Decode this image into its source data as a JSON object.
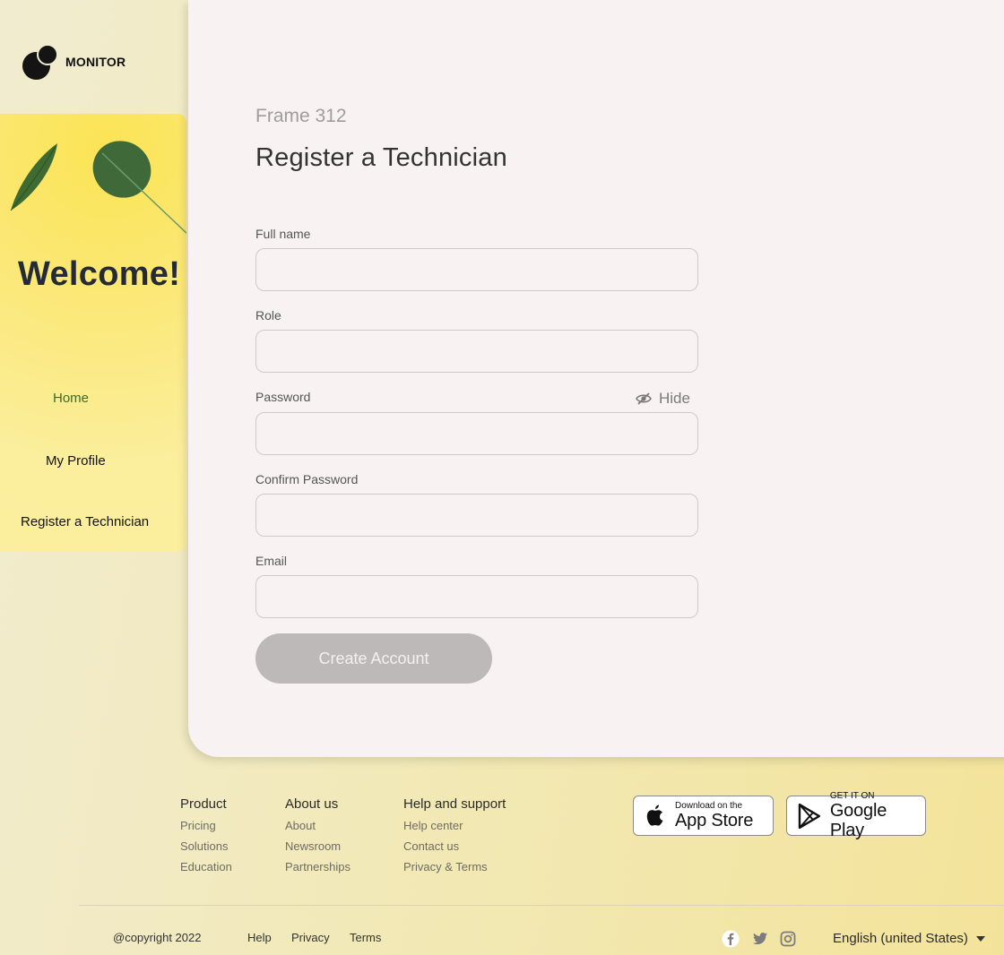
{
  "brand": {
    "name": "MONITOR"
  },
  "sidebar": {
    "welcome": "Welcome!",
    "items": [
      {
        "label": "Home",
        "active": true
      },
      {
        "label": "My Profile",
        "active": false
      },
      {
        "label": "Register a Technician",
        "active": false
      }
    ]
  },
  "main": {
    "frame_label": "Frame 312",
    "title": "Register a Technician",
    "fields": [
      {
        "label": "Full name",
        "value": ""
      },
      {
        "label": "Role",
        "value": ""
      },
      {
        "label": "Password",
        "value": ""
      },
      {
        "label": "Confirm Password",
        "value": ""
      },
      {
        "label": "Email",
        "value": ""
      }
    ],
    "password_toggle": "Hide",
    "submit_label": "Create Account"
  },
  "footer": {
    "columns": [
      {
        "heading": "Product",
        "links": [
          "Pricing",
          "Solutions",
          "Education"
        ]
      },
      {
        "heading": "About us",
        "links": [
          "About",
          "Newsroom",
          "Partnerships"
        ]
      },
      {
        "heading": "Help and support",
        "links": [
          "Help center",
          "Contact us",
          "Privacy & Terms"
        ]
      }
    ],
    "app_store": {
      "small": "Download on the",
      "big": "App Store"
    },
    "google_play": {
      "small": "GET IT ON",
      "big": "Google Play"
    },
    "copyright": "@copyright 2022",
    "bottom_links": [
      "Help",
      "Privacy",
      "Terms"
    ],
    "social_icons": [
      "facebook-icon",
      "twitter-icon",
      "instagram-icon"
    ],
    "language": "English (united States)"
  },
  "colors": {
    "accent_green": "#3e6a2a",
    "sidebar_yellow": "#fbe454",
    "button_disabled": "#bdb9b9",
    "card_bg": "#f8f3f2"
  }
}
